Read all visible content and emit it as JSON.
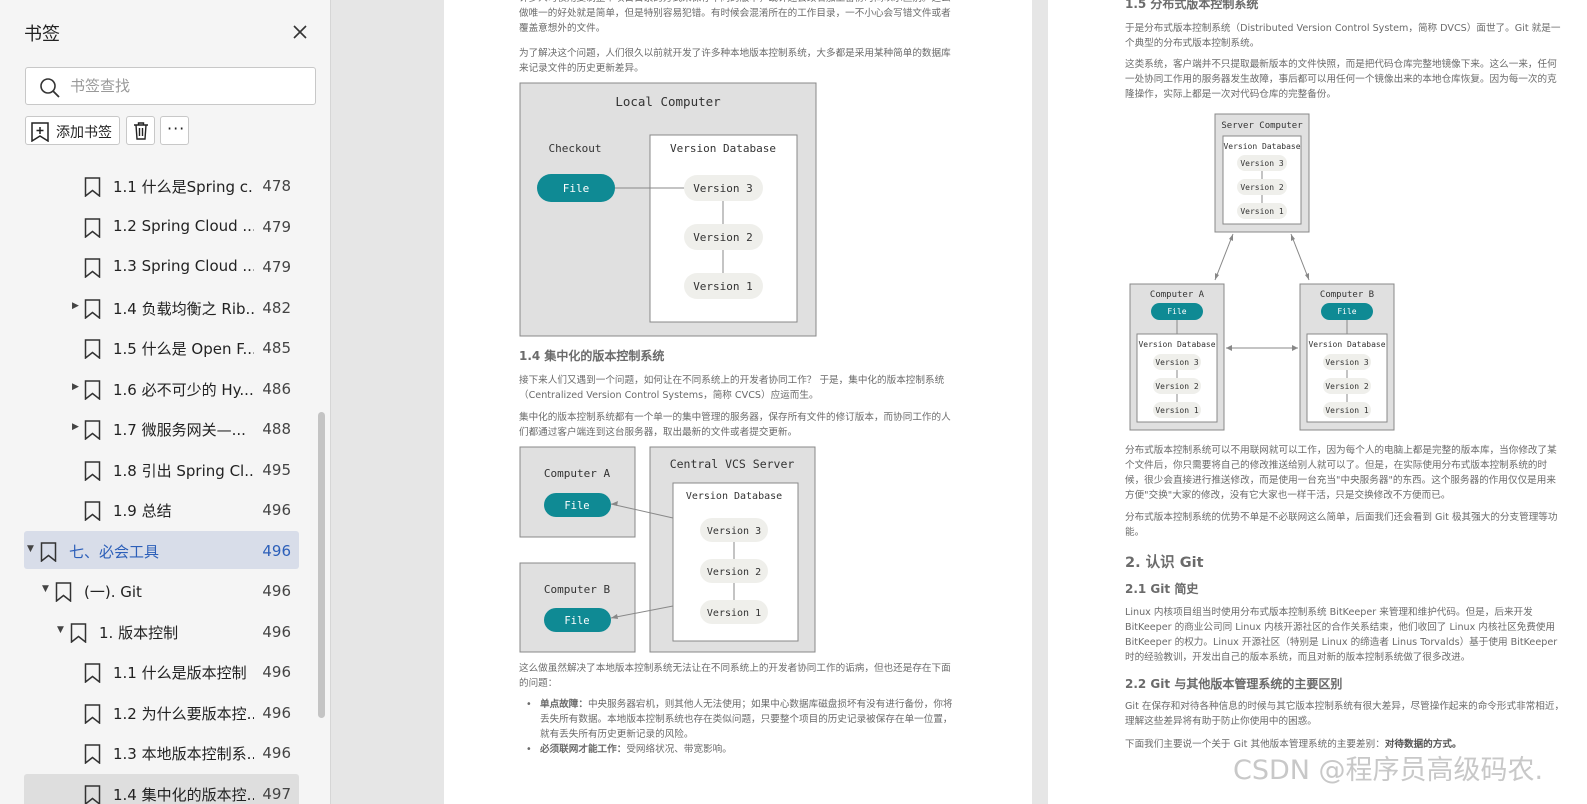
{
  "sidebar": {
    "title": "书签",
    "search_placeholder": "书签查找",
    "add_label": "添加书签",
    "more_label": "···",
    "items": [
      {
        "label": "1.1 什么是Spring c...",
        "page": "478"
      },
      {
        "label": "1.2 Spring Cloud ...",
        "page": "479"
      },
      {
        "label": "1.3 Spring Cloud ...",
        "page": "479"
      },
      {
        "label": "1.4 负载均衡之 Rib...",
        "page": "482"
      },
      {
        "label": "1.5 什么是 Open F...",
        "page": "485"
      },
      {
        "label": "1.6 必不可少的 Hy...",
        "page": "486"
      },
      {
        "label": "1.7 微服务网关—...",
        "page": "488"
      },
      {
        "label": "1.8 引出 Spring Cl...",
        "page": "495"
      },
      {
        "label": "1.9 总结",
        "page": "496"
      },
      {
        "label": "七、必会工具",
        "page": "496"
      },
      {
        "label": "(一). Git",
        "page": "496"
      },
      {
        "label": "1. 版本控制",
        "page": "496"
      },
      {
        "label": "1.1 什么是版本控制",
        "page": "496"
      },
      {
        "label": "1.2 为什么要版本控...",
        "page": "496"
      },
      {
        "label": "1.3 本地版本控制系...",
        "page": "496"
      },
      {
        "label": "1.4 集中化的版本控...",
        "page": "497"
      }
    ]
  },
  "left_page": {
    "para0": "许多人习惯用复制整个项目目录的方式来保存不同的版本，或许还会改名加上备份时间以示区别。这么做唯一的好处就是简单，但是特别容易犯错。有时候会混淆所在的工作目录，一不小心会写错文件或者覆盖意想外的文件。",
    "para1": "为了解决这个问题，人们很久以前就开发了许多种本地版本控制系统，大多都是采用某种简单的数据库来记录文件的历史更新差异。",
    "diagram1": {
      "title": "Local Computer",
      "checkout": "Checkout",
      "file": "File",
      "db_title": "Version Database",
      "versions": [
        "Version 3",
        "Version 2",
        "Version 1"
      ]
    },
    "heading": "1.4 集中化的版本控制系统",
    "para2": "接下来人们又遇到一个问题，如何让在不同系统上的开发者协同工作？ 于是，集中化的版本控制系统（Centralized Version Control Systems，简称 CVCS）应运而生。",
    "para3": "集中化的版本控制系统都有一个单一的集中管理的服务器，保存所有文件的修订版本，而协同工作的人们都通过客户端连到这台服务器，取出最新的文件或者提交更新。",
    "diagram2": {
      "computer_a": "Computer A",
      "computer_b": "Computer B",
      "server": "Central VCS Server",
      "file": "File",
      "db_title": "Version Database",
      "versions": [
        "Version 3",
        "Version 2",
        "Version 1"
      ]
    },
    "para4": "这么做虽然解决了本地版本控制系统无法让在不同系统上的开发者协同工作的诟病，但也还是存在下面的问题：",
    "bullet1_bold": "单点故障：",
    "bullet1": "中央服务器宕机，则其他人无法使用；如果中心数据库磁盘损坏有没有进行备份，你将丢失所有数据。本地版本控制系统也存在类似问题，只要整个项目的历史记录被保存在单一位置，就有丢失所有历史更新记录的风险。",
    "bullet2_bold": "必须联网才能工作：",
    "bullet2": "受网络状况、带宽影响。"
  },
  "right_page": {
    "heading_top": "1.5 分布式版本控制系统",
    "para1": "于是分布式版本控制系统（Distributed Version Control System，简称 DVCS）面世了。Git 就是一个典型的分布式版本控制系统。",
    "para2": "这类系统，客户端并不只提取最新版本的文件快照，而是把代码仓库完整地镜像下来。这么一来，任何一处协同工作用的服务器发生故障，事后都可以用任何一个镜像出来的本地仓库恢复。因为每一次的克隆操作，实际上都是一次对代码仓库的完整备份。",
    "diagram": {
      "server": "Server Computer",
      "computer_a": "Computer A",
      "computer_b": "Computer B",
      "file": "File",
      "db_title": "Version Database",
      "versions": [
        "Version 3",
        "Version 2",
        "Version 1"
      ]
    },
    "para3": "分布式版本控制系统可以不用联网就可以工作，因为每个人的电脑上都是完整的版本库，当你修改了某个文件后，你只需要将自己的修改推送给别人就可以了。但是，在实际使用分布式版本控制系统的时候，很少会直接进行推送修改，而是使用一台充当\"中央服务器\"的东西。这个服务器的作用仅仅是用来方便\"交换\"大家的修改，没有它大家也一样干活，只是交换修改不方便而已。",
    "para4": "分布式版本控制系统的优势不单是不必联网这么简单，后面我们还会看到 Git 极其强大的分支管理等功能。",
    "h2": "2. 认识 Git",
    "h3a": "2.1 Git 简史",
    "para5": "Linux 内核项目组当时使用分布式版本控制系统 BitKeeper 来管理和维护代码。但是，后来开发 BitKeeper 的商业公司同 Linux 内核开源社区的合作关系结束，他们收回了 Linux 内核社区免费使用 BitKeeper 的权力。Linux 开源社区（特别是 Linux 的缔造者 Linus Torvalds）基于使用 BitKeeper 时的经验教训，开发出自己的版本系统，而且对新的版本控制系统做了很多改进。",
    "h3b": "2.2 Git 与其他版本管理系统的主要区别",
    "para6": "Git 在保存和对待各种信息的时候与其它版本控制系统有很大差异，尽管操作起来的命令形式非常相近，理解这些差异将有助于防止你使用中的困惑。",
    "para7_pre": "下面我们主要说一个关于 Git 其他版本管理系统的主要差别：",
    "para7_bold": "对待数据的方式。"
  },
  "watermark": "CSDN @程序员高级码农."
}
